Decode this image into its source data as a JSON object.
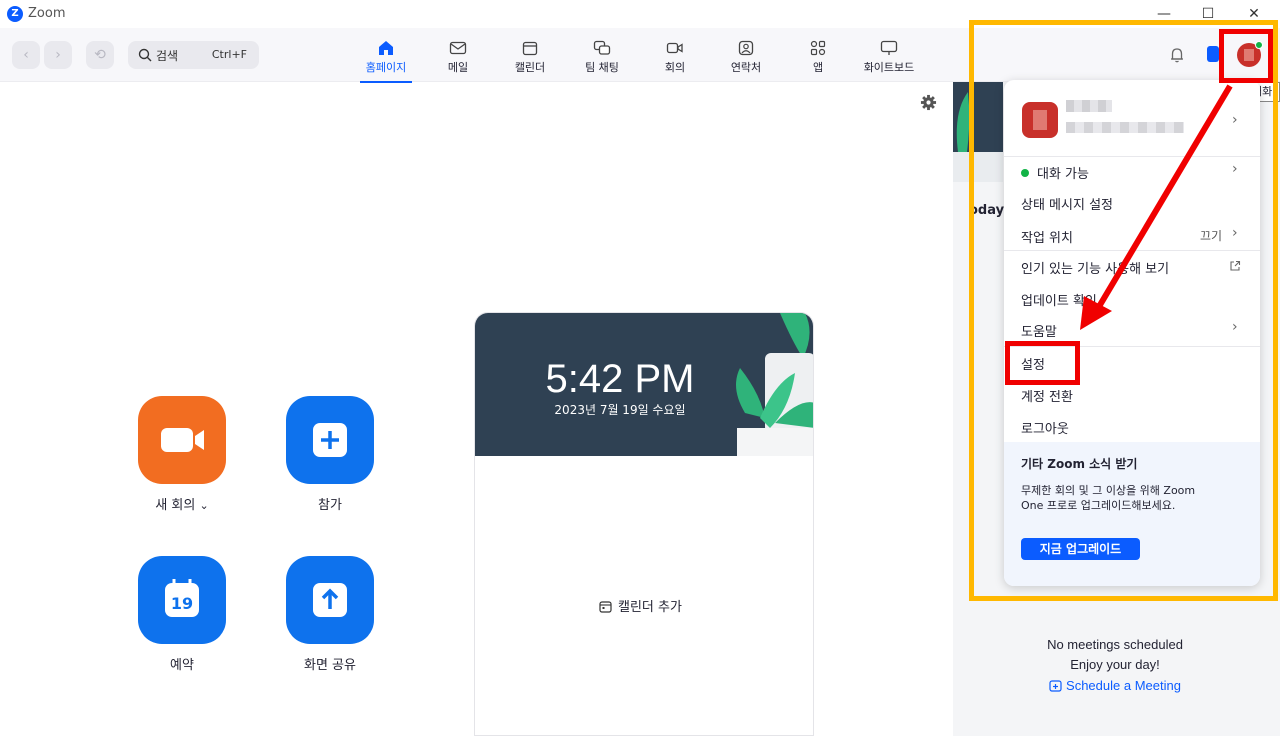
{
  "window": {
    "title": "Zoom",
    "logo_letter": "Z",
    "minimize_glyph": "—",
    "maximize_glyph": "☐",
    "close_glyph": "✕"
  },
  "toolbar": {
    "back_glyph": "‹",
    "forward_glyph": "›",
    "history_glyph": "⟲",
    "search_label": "검색",
    "search_shortcut": "Ctrl+F",
    "tabs": [
      {
        "label": "홈페이지",
        "icon": "home-icon",
        "active": true
      },
      {
        "label": "메일",
        "icon": "mail-icon"
      },
      {
        "label": "캘린더",
        "icon": "calendar-icon"
      },
      {
        "label": "팀 채팅",
        "icon": "chat-icon"
      },
      {
        "label": "회의",
        "icon": "video-icon"
      },
      {
        "label": "연락처",
        "icon": "contacts-icon"
      },
      {
        "label": "앱",
        "icon": "apps-icon"
      },
      {
        "label": "화이트보드",
        "icon": "whiteboard-icon"
      }
    ],
    "avatar_tooltip": "대화"
  },
  "actions": {
    "new_meeting": "새 회의",
    "new_meeting_caret": "⌄",
    "join": "참가",
    "schedule": "예약",
    "schedule_day": "19",
    "share_screen": "화면 공유"
  },
  "clock": {
    "time": "5:42 PM",
    "date": "2023년 7월 19일 수요일",
    "add_calendar": "캘린더 추가"
  },
  "right_panel": {
    "today_label": "oday",
    "no_meetings": "No meetings scheduled",
    "enjoy": "Enjoy your day!",
    "schedule_link": "Schedule a Meeting"
  },
  "profile_menu": {
    "items": [
      {
        "key": "status",
        "label": "대화 가능"
      },
      {
        "key": "status_message",
        "label": "상태 메시지 설정"
      },
      {
        "key": "work_location",
        "label": "작업 위치",
        "value": "끄기"
      },
      {
        "key": "popular_features",
        "label": "인기 있는 기능 사용해 보기"
      },
      {
        "key": "check_updates",
        "label": "업데이트 확인"
      },
      {
        "key": "help",
        "label": "도움말"
      },
      {
        "key": "settings",
        "label": "설정"
      },
      {
        "key": "switch_account",
        "label": "계정 전환"
      },
      {
        "key": "logout",
        "label": "로그아웃"
      }
    ],
    "promo_title": "기타 Zoom 소식 받기",
    "promo_text": "무제한 회의 및 그 이상을 위해 Zoom One 프로로 업그레이드해보세요.",
    "promo_button": "지금 업그레이드"
  },
  "colors": {
    "brand_blue": "#0b5cff",
    "orange": "#f26d21",
    "annotation_red": "#f00000",
    "annotation_yellow": "#ffb800"
  }
}
